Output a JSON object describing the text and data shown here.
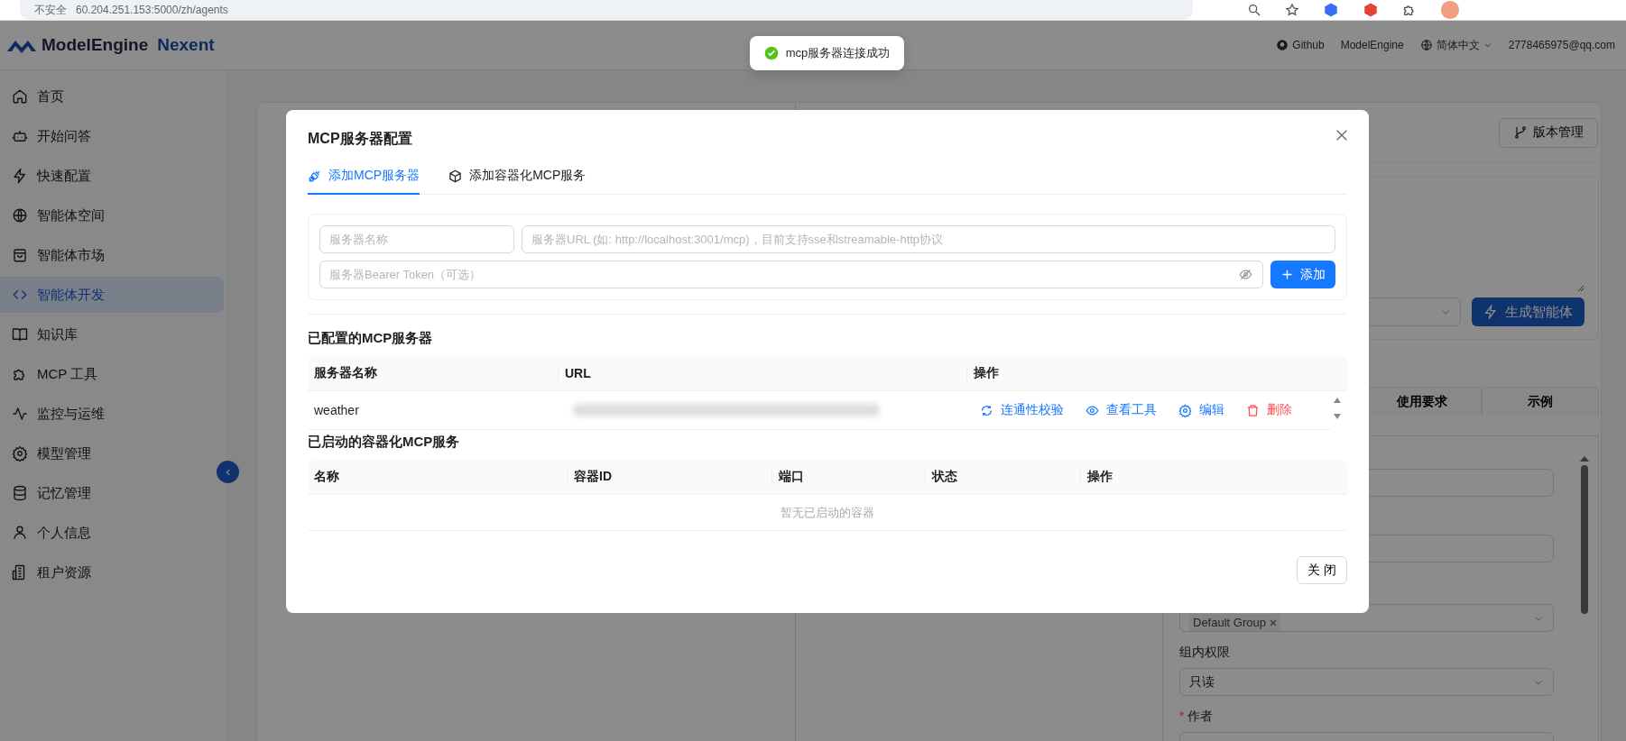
{
  "browser": {
    "security": "不安全",
    "url": "60.204.251.153:5000/zh/agents"
  },
  "header": {
    "brand": "ModelEngine",
    "product": "Nexent",
    "links": [
      "Github",
      "ModelEngine"
    ],
    "language": "简体中文",
    "user": "2778465975@qq.com"
  },
  "toast": {
    "text": "mcp服务器连接成功",
    "kind": "success"
  },
  "sidebar": {
    "items": [
      {
        "label": "首页",
        "selected": false
      },
      {
        "label": "开始问答",
        "selected": false
      },
      {
        "label": "快速配置",
        "selected": false
      },
      {
        "label": "智能体空间",
        "selected": false
      },
      {
        "label": "智能体市场",
        "selected": false
      },
      {
        "label": "智能体开发",
        "selected": true
      },
      {
        "label": "知识库",
        "selected": false
      },
      {
        "label": "MCP 工具",
        "selected": false
      },
      {
        "label": "监控与运维",
        "selected": false
      },
      {
        "label": "模型管理",
        "selected": false
      },
      {
        "label": "记忆管理",
        "selected": false
      },
      {
        "label": "个人信息",
        "selected": false
      },
      {
        "label": "租户资源",
        "selected": false
      }
    ]
  },
  "background": {
    "version_button": "版本管理",
    "generate_button": "生成智能体",
    "tabs": [
      {
        "label": "使用要求",
        "selected": false
      },
      {
        "label": "示例",
        "selected": false
      }
    ],
    "group_tag": "Default Group",
    "permission_label": "组内权限",
    "permission_value": "只读",
    "author_label": "作者",
    "required_mark": "*"
  },
  "modal": {
    "title": "MCP服务器配置",
    "tabs": [
      {
        "label": "添加MCP服务器",
        "selected": true
      },
      {
        "label": "添加容器化MCP服务",
        "selected": false
      }
    ],
    "form": {
      "name_placeholder": "服务器名称",
      "url_placeholder": "服务器URL (如: http://localhost:3001/mcp)，目前支持sse和streamable-http协议",
      "token_placeholder": "服务器Bearer Token（可选）",
      "add_button": "添加"
    },
    "configured": {
      "title": "已配置的MCP服务器",
      "columns": [
        "服务器名称",
        "URL",
        "操作"
      ],
      "rows": [
        {
          "name": "weather",
          "actions": [
            {
              "label": "连通性校验",
              "kind": "primary"
            },
            {
              "label": "查看工具",
              "kind": "primary"
            },
            {
              "label": "编辑",
              "kind": "primary"
            },
            {
              "label": "删除",
              "kind": "danger"
            }
          ]
        }
      ]
    },
    "containers": {
      "title": "已启动的容器化MCP服务",
      "columns": [
        "名称",
        "容器ID",
        "端口",
        "状态",
        "操作"
      ],
      "empty": "暂无已启动的容器"
    },
    "close_button": "关 闭"
  }
}
